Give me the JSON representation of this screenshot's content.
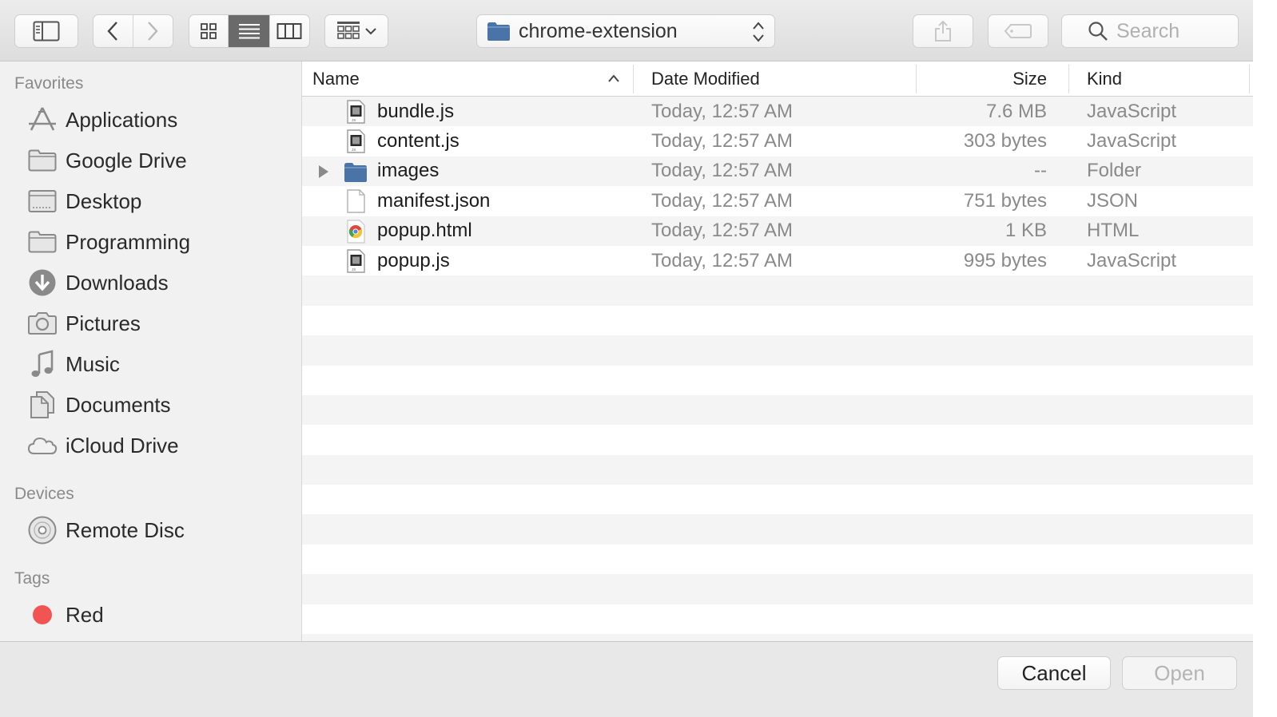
{
  "toolbar": {
    "path_label": "chrome-extension",
    "search_placeholder": "Search"
  },
  "sidebar": {
    "favorites_title": "Favorites",
    "favorites": [
      {
        "label": "Applications",
        "icon": "applications-icon"
      },
      {
        "label": "Google Drive",
        "icon": "folder-icon"
      },
      {
        "label": "Desktop",
        "icon": "desktop-icon"
      },
      {
        "label": "Programming",
        "icon": "folder-icon"
      },
      {
        "label": "Downloads",
        "icon": "downloads-icon"
      },
      {
        "label": "Pictures",
        "icon": "camera-icon"
      },
      {
        "label": "Music",
        "icon": "music-note-icon"
      },
      {
        "label": "Documents",
        "icon": "documents-icon"
      },
      {
        "label": "iCloud Drive",
        "icon": "cloud-icon"
      }
    ],
    "devices_title": "Devices",
    "devices": [
      {
        "label": "Remote Disc",
        "icon": "disc-icon"
      }
    ],
    "tags_title": "Tags",
    "tags": [
      {
        "label": "Red",
        "color": "#f25454"
      }
    ]
  },
  "list": {
    "columns": {
      "name": "Name",
      "date": "Date Modified",
      "size": "Size",
      "kind": "Kind"
    },
    "files": [
      {
        "name": "bundle.js",
        "date": "Today, 12:57 AM",
        "size": "7.6 MB",
        "kind": "JavaScript",
        "icon": "js-file-icon"
      },
      {
        "name": "content.js",
        "date": "Today, 12:57 AM",
        "size": "303 bytes",
        "kind": "JavaScript",
        "icon": "js-file-icon"
      },
      {
        "name": "images",
        "date": "Today, 12:57 AM",
        "size": "--",
        "kind": "Folder",
        "icon": "folder-icon"
      },
      {
        "name": "manifest.json",
        "date": "Today, 12:57 AM",
        "size": "751 bytes",
        "kind": "JSON",
        "icon": "blank-file-icon"
      },
      {
        "name": "popup.html",
        "date": "Today, 12:57 AM",
        "size": "1 KB",
        "kind": "HTML",
        "icon": "chrome-html-icon"
      },
      {
        "name": "popup.js",
        "date": "Today, 12:57 AM",
        "size": "995 bytes",
        "kind": "JavaScript",
        "icon": "js-file-icon"
      }
    ]
  },
  "buttons": {
    "cancel": "Cancel",
    "open": "Open"
  },
  "colors": {
    "folder_blue": "#4a74a8",
    "tag_red": "#f25454",
    "active_segment": "#6a6a6a"
  }
}
